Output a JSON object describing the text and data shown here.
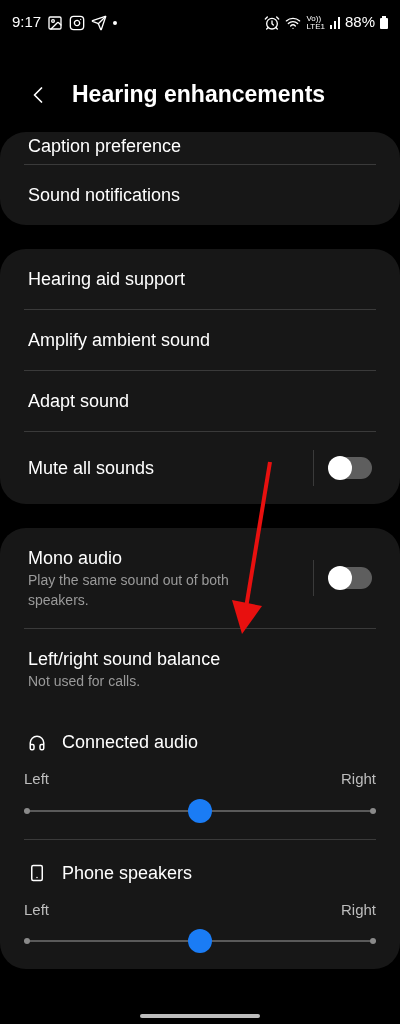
{
  "status_bar": {
    "time": "9:17",
    "network_top": "Vo))",
    "network_bottom": "LTE1",
    "battery": "88%"
  },
  "header": {
    "title": "Hearing enhancements"
  },
  "groups": [
    {
      "items": [
        {
          "kind": "plain",
          "title": "Caption preference"
        },
        {
          "kind": "plain",
          "title": "Sound notifications"
        }
      ]
    },
    {
      "items": [
        {
          "kind": "plain",
          "title": "Hearing aid support"
        },
        {
          "kind": "plain",
          "title": "Amplify ambient sound"
        },
        {
          "kind": "plain",
          "title": "Adapt sound"
        },
        {
          "kind": "toggle",
          "title": "Mute all sounds",
          "on": false
        }
      ]
    },
    {
      "items": [
        {
          "kind": "toggle",
          "title": "Mono audio",
          "subtitle": "Play the same sound out of both speakers.",
          "on": false
        },
        {
          "kind": "plain",
          "title": "Left/right sound balance",
          "subtitle": "Not used for calls."
        },
        {
          "kind": "headphones_balance",
          "title": "Connected audio",
          "left": "Left",
          "right": "Right",
          "level": 0.5
        },
        {
          "kind": "phone_balance",
          "title": "Phone speakers",
          "left": "Left",
          "right": "Right",
          "level": 0.5
        }
      ]
    }
  ]
}
